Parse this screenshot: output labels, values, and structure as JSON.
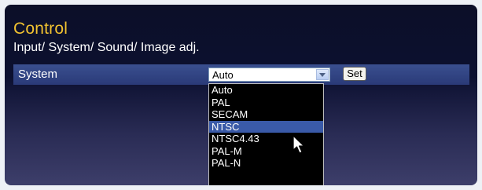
{
  "panel": {
    "title": "Control",
    "subtitle": "Input/ System/ Sound/ Image adj."
  },
  "system_row": {
    "label": "System",
    "select_value": "Auto",
    "set_label": "Set"
  },
  "dropdown": {
    "options": [
      "Auto",
      "PAL",
      "SECAM",
      "NTSC",
      "NTSC4.43",
      "PAL-M",
      "PAL-N"
    ],
    "highlighted": "NTSC"
  },
  "colors": {
    "title": "#f2c230",
    "highlight": "#3a5aa8",
    "row_background": "#2f4283"
  },
  "icons": {
    "select_arrow": "chevron-down-icon",
    "pointer": "mouse-pointer-icon"
  }
}
